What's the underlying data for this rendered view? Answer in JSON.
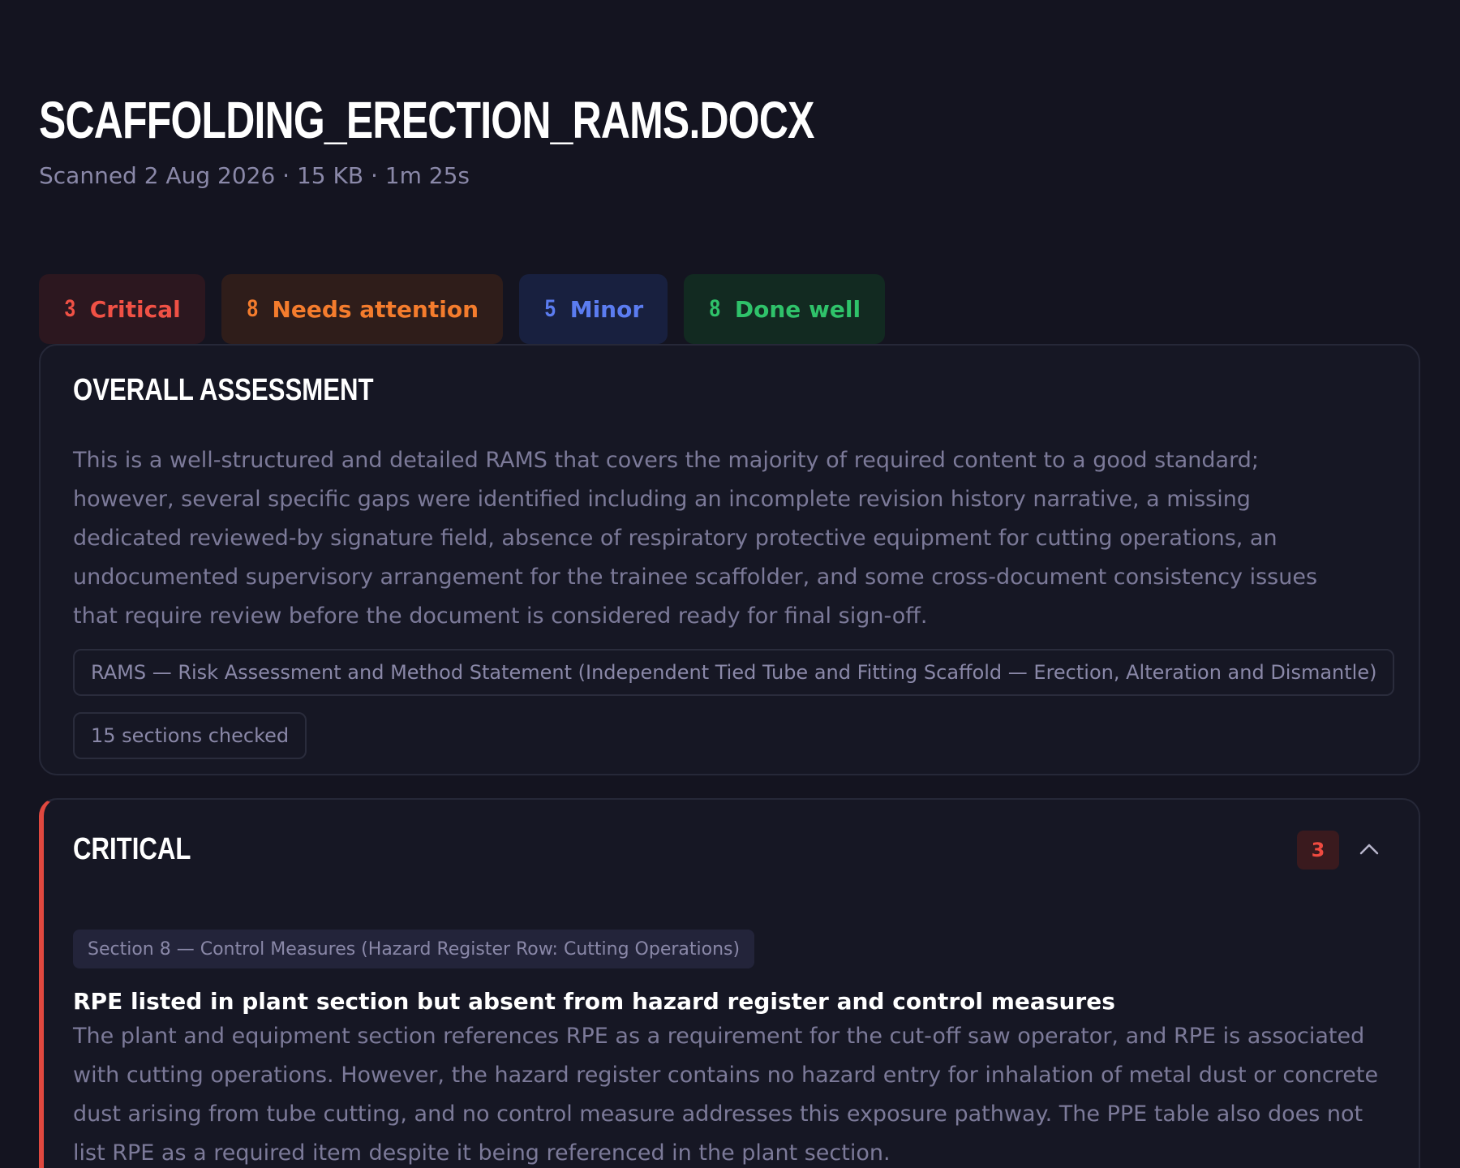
{
  "document": {
    "title": "SCAFFOLDING_ERECTION_RAMS.DOCX",
    "meta": "Scanned 2 Aug 2026 · 15 KB · 1m 25s"
  },
  "summary_chips": [
    {
      "count": "3",
      "label": "Critical",
      "color": "#f05145"
    },
    {
      "count": "8",
      "label": "Needs attention",
      "color": "#f47c2d"
    },
    {
      "count": "5",
      "label": "Minor",
      "color": "#5b7cf0"
    },
    {
      "count": "8",
      "label": "Done well",
      "color": "#2fc26a"
    }
  ],
  "overall": {
    "heading": "OVERALL ASSESSMENT",
    "summary": "This is a well-structured and detailed RAMS that covers the majority of required content to a good standard; however, several specific gaps were identified including an incomplete revision history narrative, a missing dedicated reviewed-by signature field, absence of respiratory protective equipment for cutting operations, an undocumented supervisory arrangement for the trainee scaffolder, and some cross-document consistency issues that require review before the document is considered ready for final sign-off.",
    "document_type": "RAMS — Risk Assessment and Method Statement (Independent Tied Tube and Fitting Scaffold — Erection, Alteration and Dismantle)",
    "sections_checked": "15 sections checked"
  },
  "critical": {
    "heading": "CRITICAL",
    "count": "3",
    "expanded": true,
    "findings": [
      {
        "section": "Section 8 — Control Measures (Hazard Register Row: Cutting Operations)",
        "title": "RPE listed in plant section but absent from hazard register and control measures",
        "body": "The plant and equipment section references RPE as a requirement for the cut-off saw operator, and RPE is associated with cutting operations. However, the hazard register contains no hazard entry for inhalation of metal dust or concrete dust arising from tube cutting, and no control measure addresses this exposure pathway. The PPE table also does not list RPE as a required item despite it being referenced in the plant section."
      }
    ]
  },
  "icons": {
    "collapse": "chevron-up-icon"
  },
  "colors": {
    "background": "#141420",
    "card": "#161724",
    "critical_accent": "#e0483f"
  }
}
